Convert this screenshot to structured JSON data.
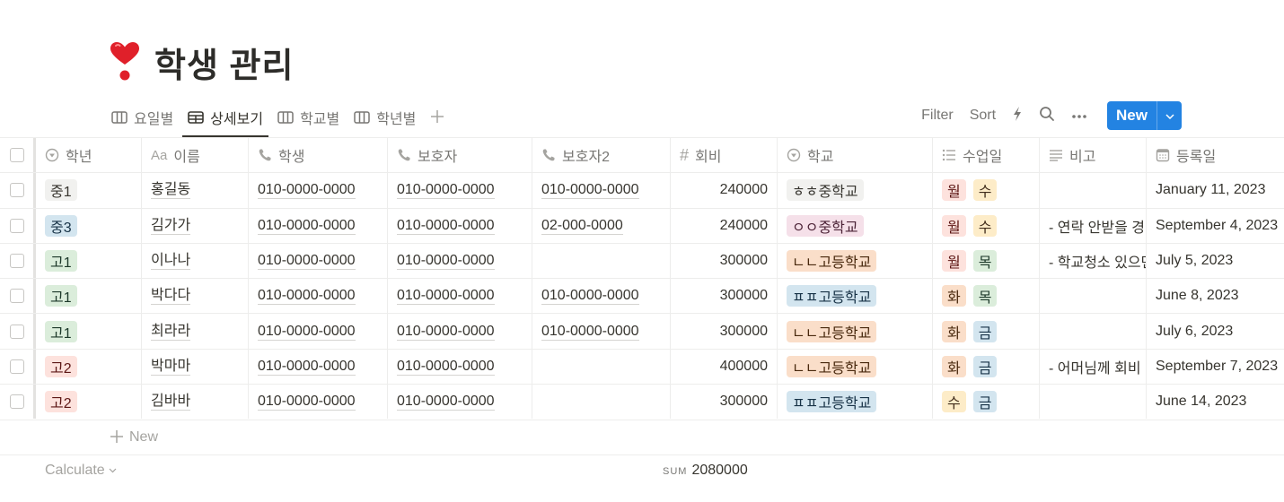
{
  "page": {
    "icon": "heart-exclamation-icon",
    "title": "학생 관리"
  },
  "views": {
    "tabs": [
      {
        "label": "요일별",
        "icon": "board-icon",
        "active": false
      },
      {
        "label": "상세보기",
        "icon": "table-icon",
        "active": true
      },
      {
        "label": "학교별",
        "icon": "board-icon",
        "active": false
      },
      {
        "label": "학년별",
        "icon": "board-icon",
        "active": false
      }
    ],
    "add_view_icon": "plus-icon"
  },
  "toolbar": {
    "filter_label": "Filter",
    "sort_label": "Sort",
    "automation_icon": "lightning-icon",
    "search_icon": "search-icon",
    "more_icon": "more-horizontal-icon",
    "new_label": "New",
    "new_dropdown_icon": "chevron-down-icon",
    "accent_color": "#2383e2"
  },
  "table": {
    "columns": [
      {
        "key": "grade",
        "label": "학년",
        "icon": "select-icon"
      },
      {
        "key": "name",
        "label": "이름",
        "icon": "title-aa-icon"
      },
      {
        "key": "student_phone",
        "label": "학생",
        "icon": "phone-icon"
      },
      {
        "key": "parent_phone",
        "label": "보호자",
        "icon": "phone-icon"
      },
      {
        "key": "parent2_phone",
        "label": "보호자2",
        "icon": "phone-icon"
      },
      {
        "key": "fee",
        "label": "회비",
        "icon": "number-icon"
      },
      {
        "key": "school",
        "label": "학교",
        "icon": "select-icon"
      },
      {
        "key": "days",
        "label": "수업일",
        "icon": "multi-select-icon"
      },
      {
        "key": "note",
        "label": "비고",
        "icon": "text-icon"
      },
      {
        "key": "registered",
        "label": "등록일",
        "icon": "calendar-icon"
      }
    ],
    "rows": [
      {
        "grade": {
          "label": "중1",
          "color": "#f1f1ef",
          "text": "#37352f"
        },
        "name": "홍길동",
        "student_phone": "010-0000-0000",
        "parent_phone": "010-0000-0000",
        "parent2_phone": "010-0000-0000",
        "fee": "240000",
        "school": {
          "label": "ㅎㅎ중학교",
          "color": "#f1f1ef",
          "text": "#37352f"
        },
        "days": [
          {
            "label": "월",
            "color": "#fde2dd",
            "text": "#5d1715"
          },
          {
            "label": "수",
            "color": "#fdecc8",
            "text": "#402c1b"
          }
        ],
        "note": "",
        "registered": "January 11, 2023"
      },
      {
        "grade": {
          "label": "중3",
          "color": "#d3e5ef",
          "text": "#183347"
        },
        "name": "김가가",
        "student_phone": "010-0000-0000",
        "parent_phone": "010-0000-0000",
        "parent2_phone": "02-000-0000",
        "fee": "240000",
        "school": {
          "label": "ㅇㅇ중학교",
          "color": "#f5e0e9",
          "text": "#4c2337"
        },
        "days": [
          {
            "label": "월",
            "color": "#fde2dd",
            "text": "#5d1715"
          },
          {
            "label": "수",
            "color": "#fdecc8",
            "text": "#402c1b"
          }
        ],
        "note": "- 연락 안받을 경",
        "registered": "September 4, 2023"
      },
      {
        "grade": {
          "label": "고1",
          "color": "#dbeddb",
          "text": "#1c3829"
        },
        "name": "이나나",
        "student_phone": "010-0000-0000",
        "parent_phone": "010-0000-0000",
        "parent2_phone": "",
        "fee": "300000",
        "school": {
          "label": "ㄴㄴ고등학교",
          "color": "#fadec9",
          "text": "#49290e"
        },
        "days": [
          {
            "label": "월",
            "color": "#fde2dd",
            "text": "#5d1715"
          },
          {
            "label": "목",
            "color": "#dbeddb",
            "text": "#1c3829"
          }
        ],
        "note": "- 학교청소 있으면",
        "registered": "July 5, 2023"
      },
      {
        "grade": {
          "label": "고1",
          "color": "#dbeddb",
          "text": "#1c3829"
        },
        "name": "박다다",
        "student_phone": "010-0000-0000",
        "parent_phone": "010-0000-0000",
        "parent2_phone": "010-0000-0000",
        "fee": "300000",
        "school": {
          "label": "ㅍㅍ고등학교",
          "color": "#d3e5ef",
          "text": "#183347"
        },
        "days": [
          {
            "label": "화",
            "color": "#fadec9",
            "text": "#49290e"
          },
          {
            "label": "목",
            "color": "#dbeddb",
            "text": "#1c3829"
          }
        ],
        "note": "",
        "registered": "June 8, 2023"
      },
      {
        "grade": {
          "label": "고1",
          "color": "#dbeddb",
          "text": "#1c3829"
        },
        "name": "최라라",
        "student_phone": "010-0000-0000",
        "parent_phone": "010-0000-0000",
        "parent2_phone": "010-0000-0000",
        "fee": "300000",
        "school": {
          "label": "ㄴㄴ고등학교",
          "color": "#fadec9",
          "text": "#49290e"
        },
        "days": [
          {
            "label": "화",
            "color": "#fadec9",
            "text": "#49290e"
          },
          {
            "label": "금",
            "color": "#d3e5ef",
            "text": "#183347"
          }
        ],
        "note": "",
        "registered": "July 6, 2023"
      },
      {
        "grade": {
          "label": "고2",
          "color": "#fde2dd",
          "text": "#5d1715"
        },
        "name": "박마마",
        "student_phone": "010-0000-0000",
        "parent_phone": "010-0000-0000",
        "parent2_phone": "",
        "fee": "400000",
        "school": {
          "label": "ㄴㄴ고등학교",
          "color": "#fadec9",
          "text": "#49290e"
        },
        "days": [
          {
            "label": "화",
            "color": "#fadec9",
            "text": "#49290e"
          },
          {
            "label": "금",
            "color": "#d3e5ef",
            "text": "#183347"
          }
        ],
        "note": "- 어머님께 회비",
        "registered": "September 7, 2023"
      },
      {
        "grade": {
          "label": "고2",
          "color": "#fde2dd",
          "text": "#5d1715"
        },
        "name": "김바바",
        "student_phone": "010-0000-0000",
        "parent_phone": "010-0000-0000",
        "parent2_phone": "",
        "fee": "300000",
        "school": {
          "label": "ㅍㅍ고등학교",
          "color": "#d3e5ef",
          "text": "#183347"
        },
        "days": [
          {
            "label": "수",
            "color": "#fdecc8",
            "text": "#402c1b"
          },
          {
            "label": "금",
            "color": "#d3e5ef",
            "text": "#183347"
          }
        ],
        "note": "",
        "registered": "June 14, 2023"
      }
    ],
    "add_row_label": "New",
    "footer": {
      "calculate_label": "Calculate",
      "sum_label": "SUM",
      "sum_value": "2080000"
    }
  }
}
